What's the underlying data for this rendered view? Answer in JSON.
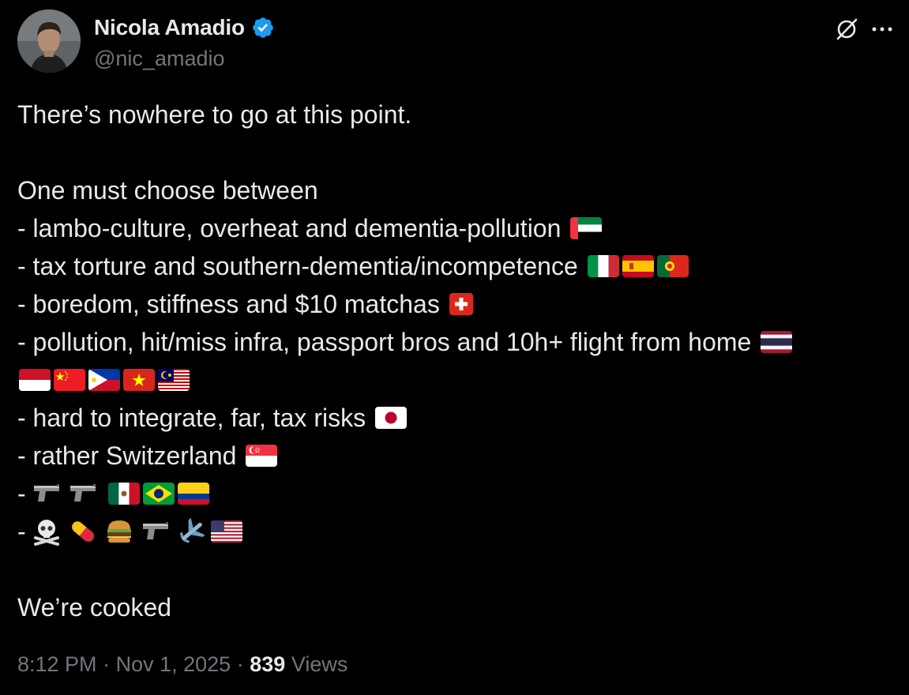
{
  "author": {
    "display_name": "Nicola Amadio",
    "handle": "@nic_amadio",
    "verified": true
  },
  "icons": {
    "verified": "verified-badge-icon",
    "grok": "grok-icon",
    "more": "more-options-icon"
  },
  "tweet": {
    "line1": "There’s nowhere to go at this point.",
    "line2": "One must choose between",
    "line3": "- lambo-culture, overheat and dementia-pollution",
    "line4": "- tax torture and southern-dementia/incompetence",
    "line5": "- boredom, stiffness and $10 matchas",
    "line6": "- pollution, hit/miss infra, passport bros and 10h+ flight from home",
    "line8": "- hard to integrate, far, tax risks",
    "line9": "- rather Switzerland",
    "line10": "-",
    "line11": "-",
    "line12": "We’re cooked"
  },
  "emoji": {
    "line3": [
      "flag-uae"
    ],
    "line4": [
      "flag-italy",
      "flag-spain",
      "flag-portugal"
    ],
    "line5": [
      "flag-switzerland"
    ],
    "line6": [
      "flag-thailand"
    ],
    "line7": [
      "flag-indonesia",
      "flag-china",
      "flag-philippines",
      "flag-vietnam",
      "flag-malaysia"
    ],
    "line8": [
      "flag-japan"
    ],
    "line9": [
      "flag-singapore"
    ],
    "line10": [
      "pistol",
      "pistol",
      "flag-mexico",
      "flag-brazil",
      "flag-colombia"
    ],
    "line11": [
      "skull-crossbones",
      "pill",
      "hamburger",
      "pistol",
      "airplane",
      "flag-usa"
    ]
  },
  "meta": {
    "time": "8:12 PM",
    "separator": "·",
    "date": "Nov 1, 2025",
    "views_count": "839",
    "views_label": "Views"
  },
  "colors": {
    "background": "#000000",
    "text_primary": "#e7e9ea",
    "text_secondary": "#71767b",
    "verified_blue": "#1d9bf0"
  }
}
